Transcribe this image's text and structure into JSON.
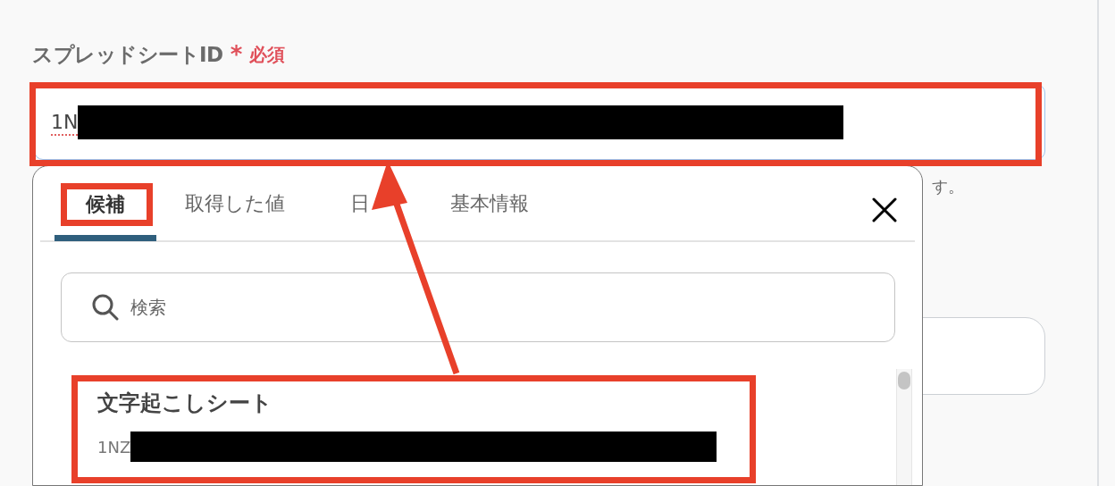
{
  "field": {
    "label": "スプレッドシートID",
    "required_mark": "*",
    "required_text": "必須",
    "value": "1N"
  },
  "hint_text": "す。",
  "dropdown": {
    "tabs": [
      {
        "label": "候補",
        "selected": true
      },
      {
        "label": "取得した値",
        "selected": false
      },
      {
        "label": "日",
        "selected": false
      },
      {
        "label": "基本情報",
        "selected": false
      }
    ],
    "search": {
      "placeholder": "検索"
    },
    "items": [
      {
        "title": "文字起こしシート",
        "subtitle": "1NZ"
      }
    ]
  }
}
